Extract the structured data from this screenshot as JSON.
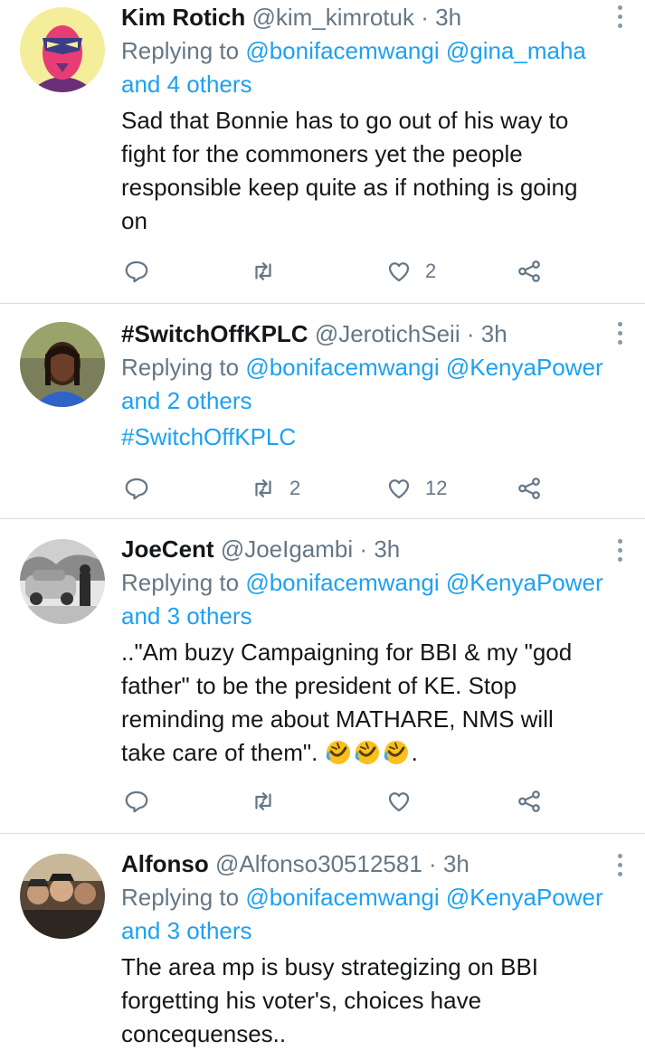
{
  "tweets": [
    {
      "name": "Kim  Rotich",
      "handle": "@kim_kimrotuk",
      "separator": "·",
      "time": "3h",
      "replying_prefix": "Replying to",
      "reply_to_1": "@bonifacemwangi",
      "reply_to_2": "@gina_maha",
      "reply_others": "and 4 others",
      "text_lines": [
        "Sad that Bonnie has to go out of his way to",
        "fight for the commoners yet the people",
        "responsible keep quite as if nothing is going",
        "on"
      ],
      "replies": "",
      "retweets": "",
      "likes": "2"
    },
    {
      "name": "#SwitchOffKPLC",
      "handle": "@JerotichSeii",
      "separator": "·",
      "time": "3h",
      "replying_prefix": "Replying to",
      "reply_to_1": "@bonifacemwangi",
      "reply_to_2": "@KenyaPower",
      "reply_others": "and 2 others",
      "text_lines": [
        "#SwitchOffKPLC"
      ],
      "replies": "",
      "retweets": "2",
      "likes": "12"
    },
    {
      "name": "JoeCent",
      "handle": "@JoeIgambi",
      "separator": "·",
      "time": "3h",
      "replying_prefix": "Replying to",
      "reply_to_1": "@bonifacemwangi",
      "reply_to_2": "@KenyaPower",
      "reply_others": "and 3 others",
      "text_lines": [
        "..\"Am buzy Campaigning for BBI & my \"god",
        "father\" to be the president of KE. Stop",
        "reminding me about MATHARE, NMS will",
        "take care of them\". "
      ],
      "text_suffix": ".",
      "emoji": "rolling-on-floor-laughing",
      "replies": "",
      "retweets": "",
      "likes": ""
    },
    {
      "name": "Alfonso",
      "handle": "@Alfonso30512581",
      "separator": "·",
      "time": "3h",
      "replying_prefix": "Replying to",
      "reply_to_1": "@bonifacemwangi",
      "reply_to_2": "@KenyaPower",
      "reply_others": "and 3 others",
      "text_lines": [
        "The area mp is busy strategizing on BBI",
        "forgetting his voter's, choices have",
        "concequenses.."
      ]
    }
  ],
  "colors": {
    "link": "#1da1f2",
    "muted": "#657786",
    "divider": "#d9dee2",
    "text": "#14171a"
  },
  "icons": [
    "reply-icon",
    "retweet-icon",
    "like-icon",
    "share-icon",
    "more-icon"
  ]
}
